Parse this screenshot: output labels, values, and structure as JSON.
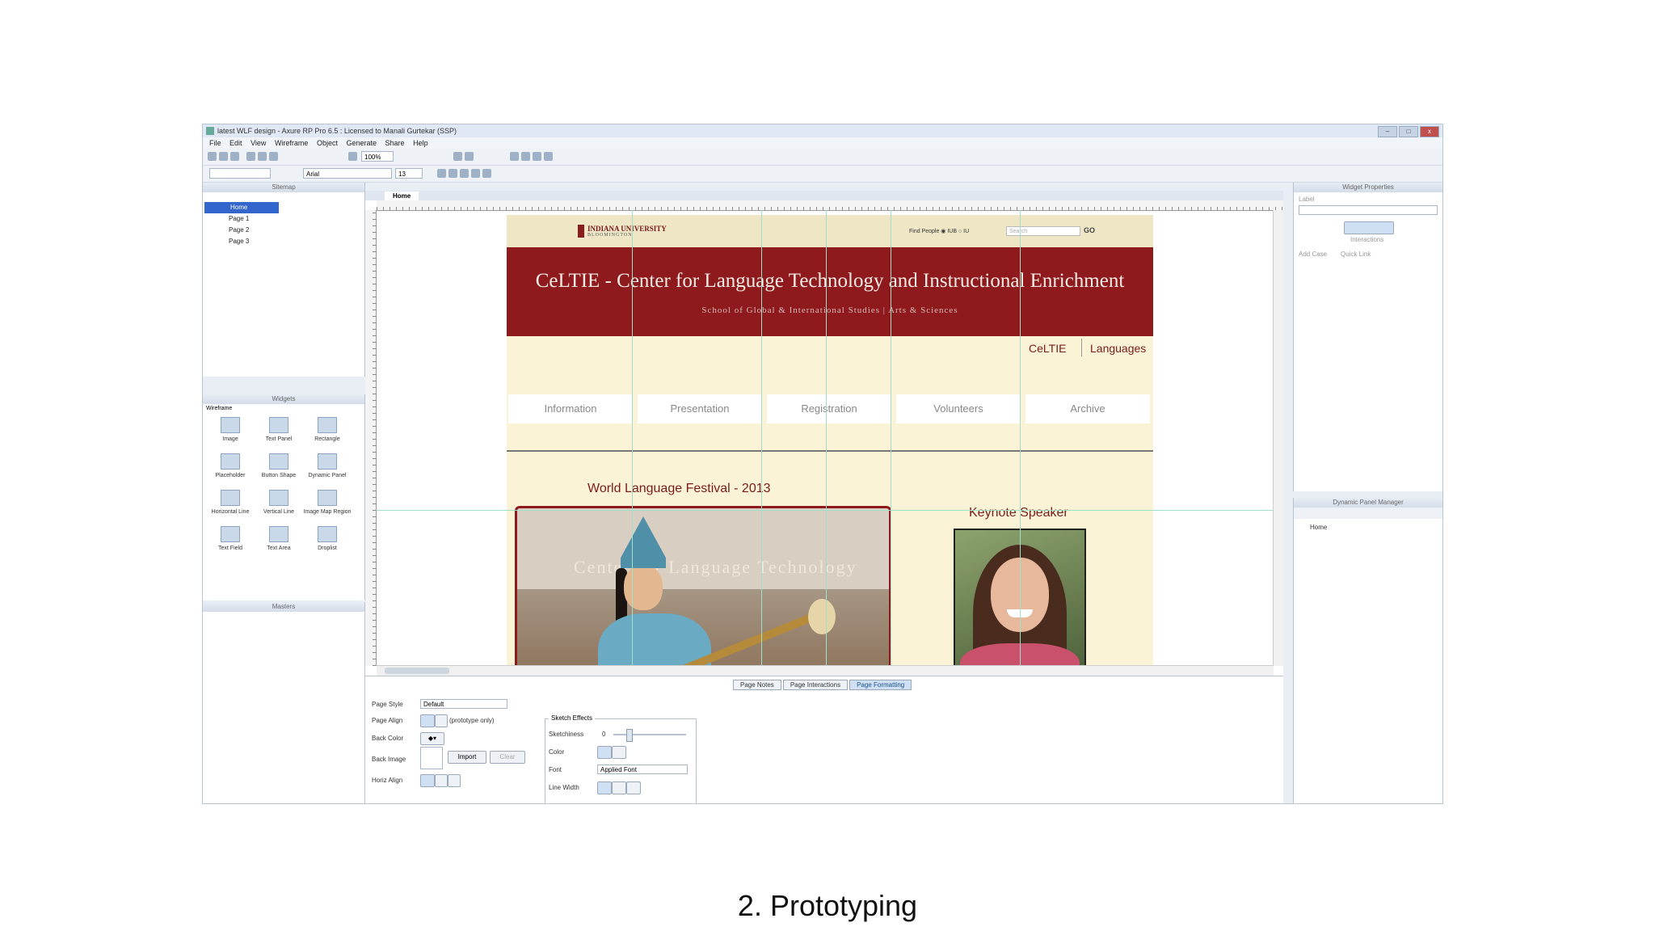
{
  "window": {
    "title": "latest WLF design - Axure RP Pro 6.5 : Licensed to Manali Gurtekar (SSP)",
    "controls": [
      "–",
      "□",
      "x"
    ]
  },
  "menu": [
    "File",
    "Edit",
    "View",
    "Wireframe",
    "Object",
    "Generate",
    "Share",
    "Help"
  ],
  "toolbar": {
    "zoom": "100%",
    "font": "Arial",
    "font_size": "13"
  },
  "sitemap": {
    "title": "Sitemap",
    "items": [
      "Home",
      "Page 1",
      "Page 2",
      "Page 3"
    ]
  },
  "widgets_panel": {
    "title": "Widgets",
    "library": "Wireframe",
    "items": [
      "Image",
      "Text Panel",
      "Rectangle",
      "Placeholder",
      "Button Shape",
      "Dynamic Panel",
      "Horizontal Line",
      "Vertical Line",
      "Image Map Region",
      "Text Field",
      "Text Area",
      "Droplist"
    ]
  },
  "masters_panel": {
    "title": "Masters"
  },
  "canvas": {
    "tab": "Home"
  },
  "mockup": {
    "university": "INDIANA UNIVERSITY",
    "campus": "BLOOMINGTON",
    "find_people": "Find People",
    "radio_iub": "IUB",
    "radio_iu": "IU",
    "search_placeholder": "Search",
    "go": "GO",
    "title": "CeLTIE - Center for Language Technology and Instructional Enrichment",
    "subtitle": "School of Global & International Studies  |  Arts & Sciences",
    "right_nav": [
      "CeLTIE",
      "Languages"
    ],
    "tabs": [
      "Information",
      "Presentation",
      "Registration",
      "Volunteers",
      "Archive"
    ],
    "festival_title": "World Language Festival - 2013",
    "keynote_title": "Keynote Speaker",
    "photo_wall_text": "Center for Language Technology"
  },
  "bottom_pane": {
    "tabs": [
      "Page Notes",
      "Page Interactions",
      "Page Formatting"
    ],
    "active_tab": "Page Formatting",
    "page_style_label": "Page Style",
    "page_style_value": "Default",
    "page_align_label": "Page Align",
    "page_align_note": "(prototype only)",
    "back_color_label": "Back Color",
    "back_image_label": "Back Image",
    "import_button": "Import",
    "clear_button": "Clear",
    "repeat_label": "Horiz Align",
    "sketch_group": "Sketch Effects",
    "sketchiness_label": "Sketchiness",
    "sketchiness_value": "0",
    "color_label": "Color",
    "font_label": "Font",
    "font_value": "Applied Font",
    "line_width_label": "Line Width"
  },
  "right_panels": {
    "widget_properties": "Widget Properties",
    "label_field": "Label",
    "interactions": "Interactions",
    "add_case": "Add Case",
    "quick_link": "Quick Link",
    "dynamic_panel_manager": "Dynamic Panel Manager",
    "dp_item": "Home"
  },
  "caption": "2. Prototyping",
  "colors": {
    "banner": "#8e1a1e",
    "page_bg": "#faf3d6",
    "accent_text": "#7a1c1c"
  }
}
